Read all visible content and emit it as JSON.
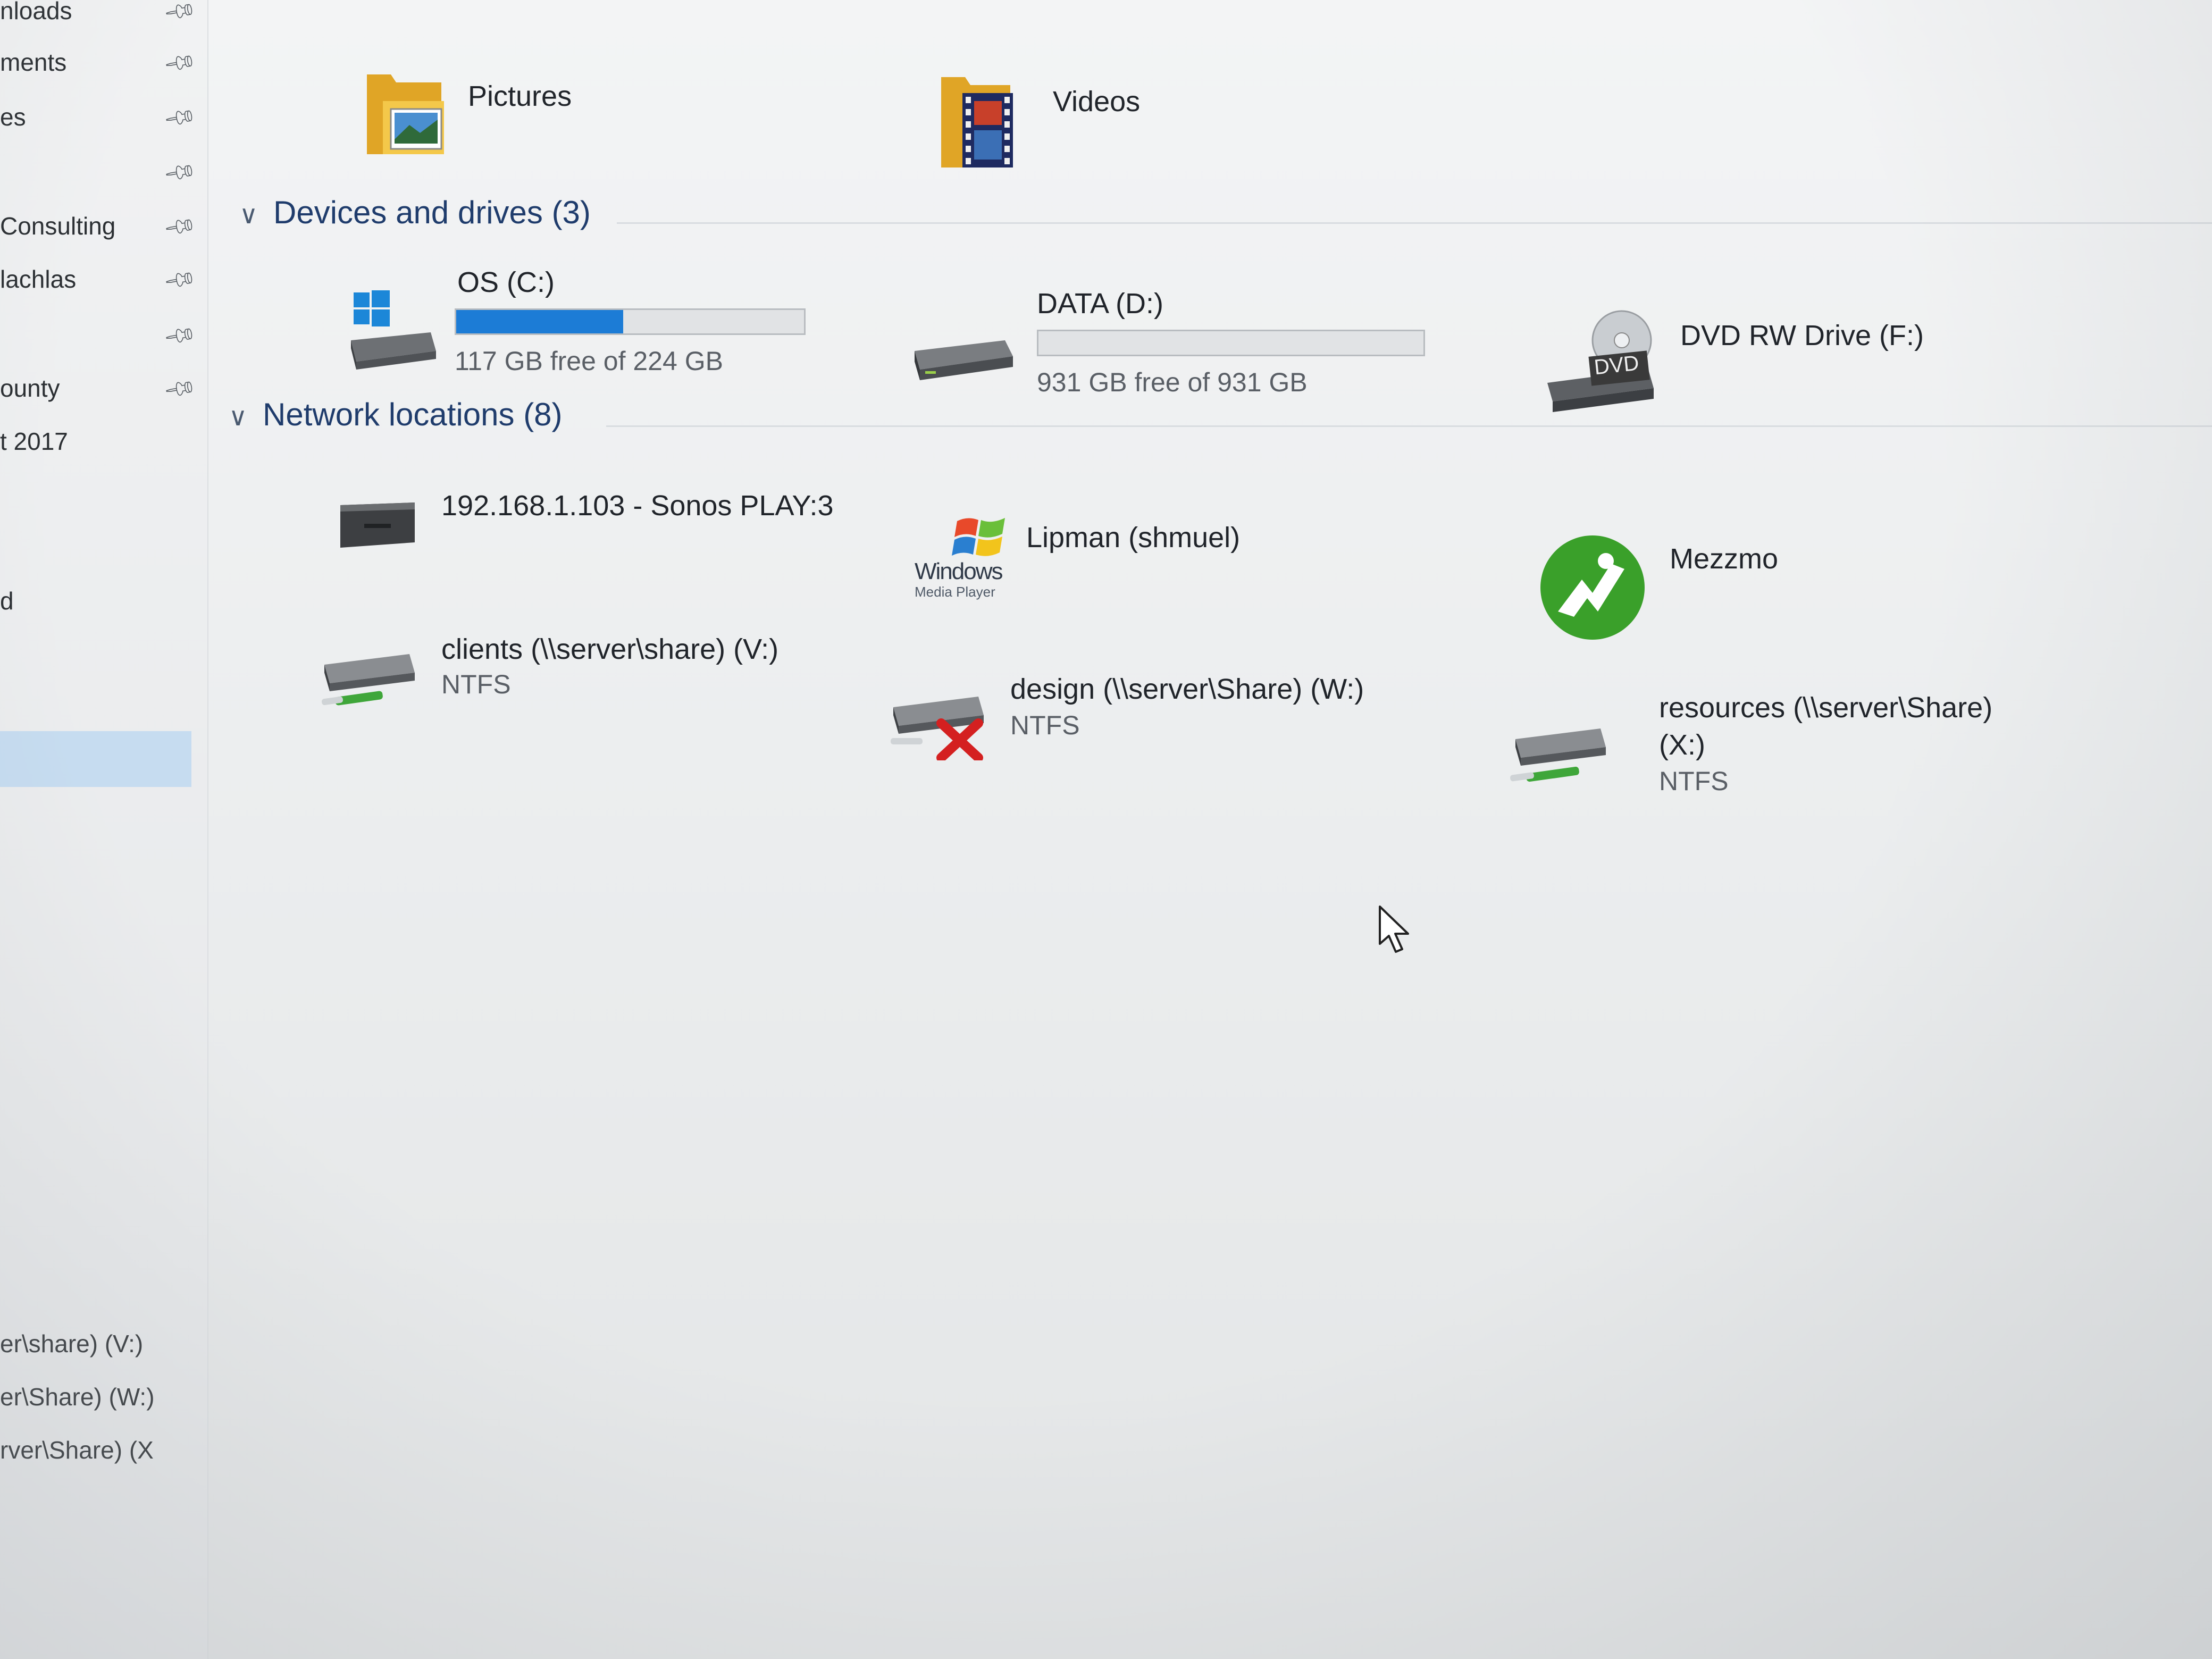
{
  "sidebar": {
    "pinned_items": [
      {
        "label": "nloads"
      },
      {
        "label": "ments"
      },
      {
        "label": "es"
      },
      {
        "label": ""
      },
      {
        "label": "Consulting"
      },
      {
        "label": "lachlas"
      },
      {
        "label": ""
      },
      {
        "label": "ounty"
      }
    ],
    "other_items": [
      {
        "label": "t 2017"
      },
      {
        "label": "d"
      },
      {
        "label": ""
      }
    ],
    "network_drives": [
      {
        "label": "er\\share) (V:)"
      },
      {
        "label": "er\\Share) (W:)"
      },
      {
        "label": "rver\\Share) (X"
      }
    ]
  },
  "folders": [
    {
      "name": "Pictures",
      "icon": "pictures-folder-icon"
    },
    {
      "name": "Videos",
      "icon": "videos-folder-icon"
    }
  ],
  "devices": {
    "header": "Devices and drives (3)",
    "items": [
      {
        "name": "OS (C:)",
        "free_text": "117 GB free of 224 GB",
        "used_fraction": 0.48,
        "icon": "windows-drive-icon"
      },
      {
        "name": "DATA (D:)",
        "free_text": "931 GB free of 931 GB",
        "used_fraction": 0.0,
        "icon": "hard-drive-icon"
      },
      {
        "name": "DVD RW Drive (F:)",
        "icon": "dvd-drive-icon",
        "badge": "DVD"
      }
    ]
  },
  "network": {
    "header": "Network locations (8)",
    "items": [
      {
        "name": "192.168.1.103 - Sonos PLAY:3",
        "icon": "sonos-speaker-icon"
      },
      {
        "name": "Lipman (shmuel)",
        "icon": "windows-media-player-icon",
        "logo_text": "Windows",
        "logo_sub": "Media Player"
      },
      {
        "name": "Mezzmo",
        "icon": "mezzmo-icon"
      },
      {
        "name": "clients (\\\\server\\share) (V:)",
        "fs": "NTFS",
        "icon": "network-drive-icon"
      },
      {
        "name": "design (\\\\server\\Share) (W:)",
        "fs": "NTFS",
        "icon": "disconnected-network-drive-icon"
      },
      {
        "name": "resources (\\\\server\\Share)",
        "name2": "(X:)",
        "fs": "NTFS",
        "icon": "network-drive-icon"
      }
    ]
  },
  "colors": {
    "accent": "#1c7cd6",
    "header_text": "#1f3c6c",
    "selection": "#c6dcf0"
  }
}
